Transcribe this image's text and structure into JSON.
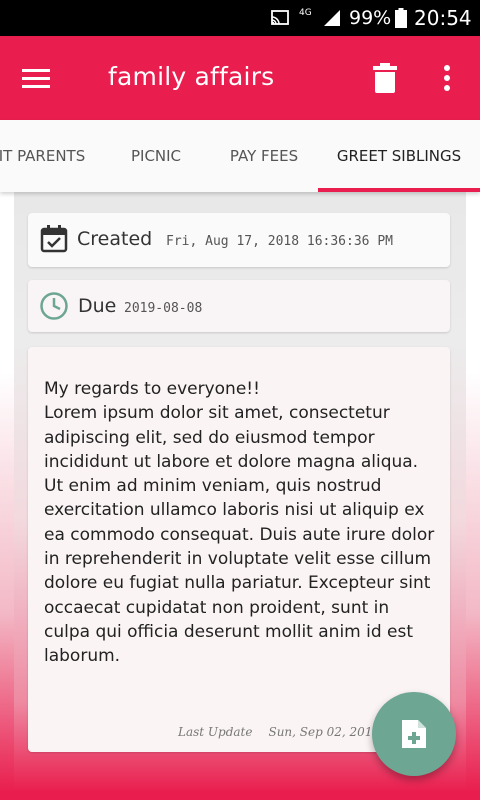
{
  "status_bar": {
    "network": "4G",
    "battery_percent": "99%",
    "time": "20:54",
    "icons": [
      "cast-icon",
      "signal-icon",
      "battery-icon"
    ]
  },
  "toolbar": {
    "title": "family affairs",
    "icons": [
      "menu-icon",
      "delete-icon",
      "more-vert-icon"
    ],
    "background": "#e91e4e"
  },
  "tabs": [
    {
      "label": "IT PARENTS",
      "active": false
    },
    {
      "label": "PICNIC",
      "active": false
    },
    {
      "label": "PAY FEES",
      "active": false
    },
    {
      "label": "GREET SIBLINGS",
      "active": true
    }
  ],
  "created": {
    "label": "Created",
    "value": "Fri, Aug 17, 2018 16:36:36 PM",
    "icon": "calendar-check-icon"
  },
  "due": {
    "label": "Due",
    "value": "2019-08-08",
    "icon": "clock-icon"
  },
  "note": {
    "text": "My regards to everyone!!\nLorem ipsum dolor sit amet, consectetur adipiscing elit, sed do eiusmod tempor incididunt ut labore et dolore magna aliqua. Ut enim ad minim veniam, quis nostrud exercitation ullamco laboris nisi ut aliquip ex ea commodo consequat. Duis aute irure dolor in reprehenderit in voluptate velit esse cillum dolore eu fugiat nulla pariatur. Excepteur sint occaecat cupidatat non proident, sunt in culpa qui officia deserunt mollit anim id est laborum.",
    "last_update_label": "Last Update",
    "last_update_value": "Sun, Sep 02, 2018 0"
  },
  "fab": {
    "icon": "add-note-icon",
    "color": "#6da693"
  },
  "colors": {
    "accent": "#e91e4e",
    "tab_indicator": "#e91e4e"
  }
}
